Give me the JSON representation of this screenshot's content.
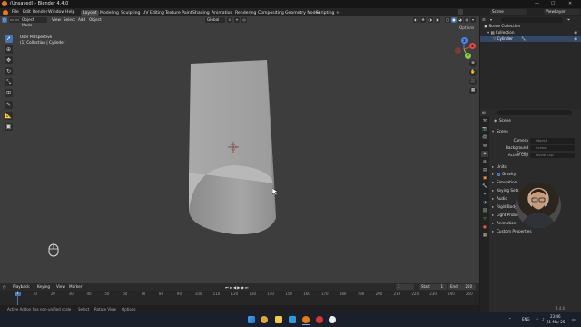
{
  "titlebar": {
    "title": "(Unsaved) - Blender 4.4.0",
    "minimize": "—",
    "maximize": "☐",
    "close": "✕"
  },
  "menu": {
    "file": "File",
    "edit": "Edit",
    "render": "Render",
    "window": "Window",
    "help": "Help"
  },
  "workspaces": [
    "Layout",
    "Modeling",
    "Sculpting",
    "UV Editing",
    "Texture Paint",
    "Shading",
    "Animation",
    "Rendering",
    "Compositing",
    "Geometry Nodes",
    "Scripting",
    "+"
  ],
  "top_right": {
    "scene_label": "Scene",
    "view_layer_label": "ViewLayer"
  },
  "viewport_header": {
    "mode": "Object Mode",
    "view": "View",
    "select": "Select",
    "add": "Add",
    "object": "Object",
    "orientation": "Global",
    "options": "Options"
  },
  "viewport_overlay": {
    "perspective": "User Perspective",
    "collection": "(1) Collection | Cylinder"
  },
  "gizmo": {
    "x": "X",
    "y": "Y",
    "z": "Z"
  },
  "outliner": {
    "search_placeholder": "",
    "rows": [
      {
        "label": "Scene Collection"
      },
      {
        "label": "Collection"
      },
      {
        "label": "Cylinder"
      }
    ]
  },
  "properties": {
    "header": "Scene",
    "search_placeholder": "",
    "section_scene": "Scene",
    "camera_label": "Camera",
    "camera_value": "Object",
    "bg_scene_label": "Background Scene",
    "bg_scene_value": "Scene",
    "active_clip_label": "Active Clip",
    "active_clip_value": "Movie Clip",
    "sections": [
      "Units",
      "Gravity",
      "Simulation",
      "Keying Sets",
      "Audio",
      "Rigid Body World",
      "Light Probes",
      "Animation",
      "Custom Properties"
    ]
  },
  "timeline": {
    "playback": "Playback",
    "keying": "Keying",
    "view": "View",
    "marker": "Marker",
    "current_frame": "1",
    "start_label": "Start",
    "start_value": "1",
    "end_label": "End",
    "end_value": "250",
    "ticks": [
      "0",
      "10",
      "20",
      "30",
      "40",
      "50",
      "60",
      "70",
      "80",
      "90",
      "100",
      "110",
      "120",
      "130",
      "140",
      "150",
      "160",
      "170",
      "180",
      "190",
      "200",
      "210",
      "220",
      "230",
      "240",
      "250"
    ]
  },
  "statusbar": {
    "hint1": "Active Addon has non-unified scale",
    "hint2": "Select",
    "hint3": "Rotate View",
    "hint4": "Options",
    "version": "4.4.0"
  },
  "tray": {
    "lang": "ENG",
    "time": "23:46",
    "date": "31-Mar-25"
  },
  "colors": {
    "accent": "#4772b3",
    "viewport_bg": "#3d3d3d",
    "taskbar": "#1b1f2a"
  }
}
